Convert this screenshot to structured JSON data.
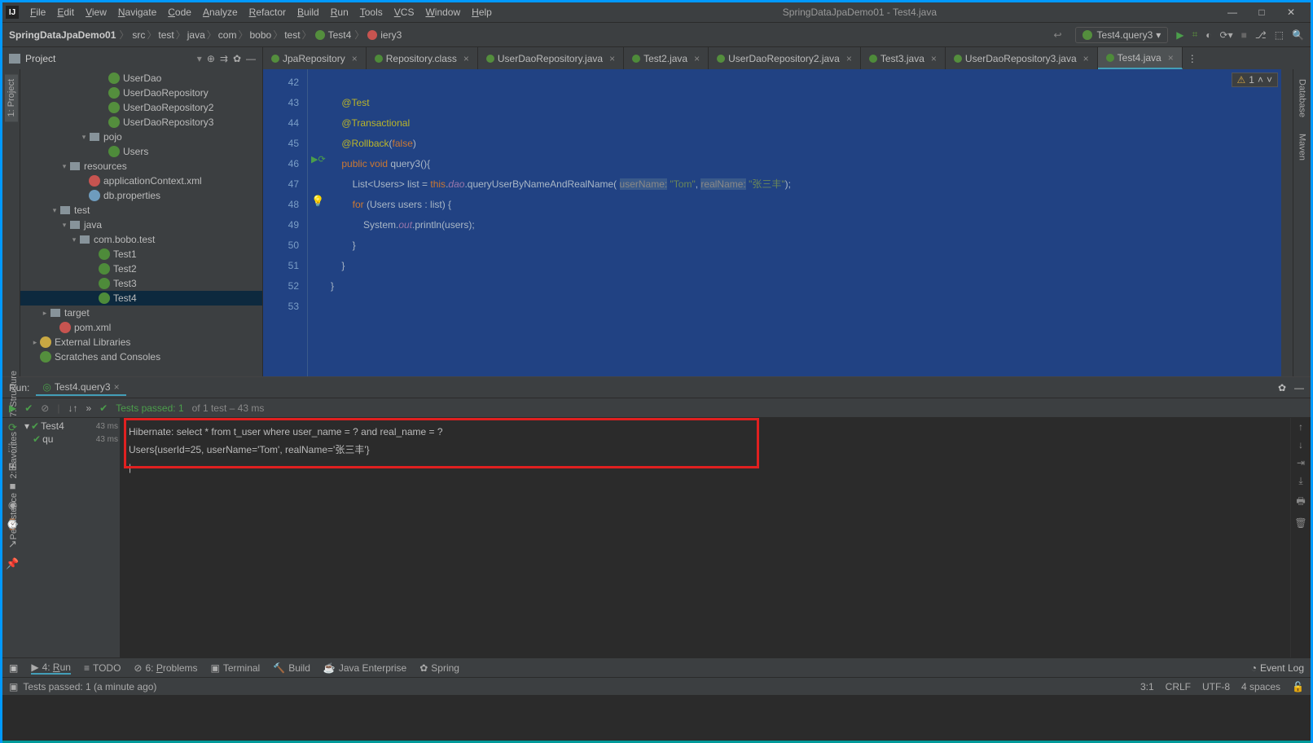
{
  "window": {
    "title": "SpringDataJpaDemo01 - Test4.java"
  },
  "menus": [
    "File",
    "Edit",
    "View",
    "Navigate",
    "Code",
    "Analyze",
    "Refactor",
    "Build",
    "Run",
    "Tools",
    "VCS",
    "Window",
    "Help"
  ],
  "breadcrumbs": {
    "project": "SpringDataJpaDemo01",
    "parts": [
      "src",
      "test",
      "java",
      "com",
      "bobo",
      "test"
    ],
    "class": "Test4",
    "method": "iery3"
  },
  "run_config": "Test4.query3",
  "project_header": "Project",
  "tree": [
    {
      "indent": 8,
      "icon": "iface",
      "label": "UserDao"
    },
    {
      "indent": 8,
      "icon": "iface",
      "label": "UserDaoRepository"
    },
    {
      "indent": 8,
      "icon": "iface",
      "label": "UserDaoRepository2"
    },
    {
      "indent": 8,
      "icon": "iface",
      "label": "UserDaoRepository3"
    },
    {
      "indent": 6,
      "arrow": "▾",
      "icon": "pkg",
      "label": "pojo"
    },
    {
      "indent": 8,
      "icon": "cls2",
      "label": "Users"
    },
    {
      "indent": 4,
      "arrow": "▾",
      "icon": "folder",
      "label": "resources"
    },
    {
      "indent": 6,
      "icon": "xml",
      "label": "applicationContext.xml"
    },
    {
      "indent": 6,
      "icon": "prop",
      "label": "db.properties"
    },
    {
      "indent": 3,
      "arrow": "▾",
      "icon": "folder",
      "label": "test"
    },
    {
      "indent": 4,
      "arrow": "▾",
      "icon": "folder",
      "label": "java"
    },
    {
      "indent": 5,
      "arrow": "▾",
      "icon": "pkg",
      "label": "com.bobo.test"
    },
    {
      "indent": 7,
      "icon": "test2",
      "label": "Test1"
    },
    {
      "indent": 7,
      "icon": "test2",
      "label": "Test2"
    },
    {
      "indent": 7,
      "icon": "test2",
      "label": "Test3"
    },
    {
      "indent": 7,
      "icon": "test2",
      "label": "Test4",
      "selected": true
    },
    {
      "indent": 2,
      "arrow": "▸",
      "icon": "folder",
      "label": "target"
    },
    {
      "indent": 3,
      "icon": "maven",
      "label": "pom.xml"
    },
    {
      "indent": 1,
      "arrow": "▸",
      "icon": "lib",
      "label": "External Libraries"
    },
    {
      "indent": 1,
      "icon": "scratch",
      "label": "Scratches and Consoles"
    }
  ],
  "tabs": [
    {
      "label": "JpaRepository",
      "icon": "int"
    },
    {
      "label": "Repository.class",
      "icon": "cls"
    },
    {
      "label": "UserDaoRepository.java",
      "icon": "int"
    },
    {
      "label": "Test2.java",
      "icon": "test"
    },
    {
      "label": "UserDaoRepository2.java",
      "icon": "int"
    },
    {
      "label": "Test3.java",
      "icon": "test"
    },
    {
      "label": "UserDaoRepository3.java",
      "icon": "int"
    },
    {
      "label": "Test4.java",
      "icon": "test",
      "active": true
    }
  ],
  "line_start": 42,
  "line_end": 53,
  "code_lines": [
    "",
    "    <ann>@Test</ann>",
    "    <ann>@Transactional</ann>",
    "    <ann>@Rollback</ann>(<kw>false</kw>)",
    "    <kw>public</kw> <kw>void</kw> query3(){",
    "        List&lt;Users&gt; list = <kw>this</kw>.<field>dao</field>.queryUserByNameAndRealName( <param>userName:</param> <str>\"Tom\"</str>, <param>realName:</param> <str>\"张三丰\"</str>);",
    "        <kw>for</kw> (Users users : list) {",
    "            System.<field>out</field>.println(users);",
    "        }",
    "    }",
    "}",
    ""
  ],
  "badge": {
    "warn": "⚠",
    "count": "1"
  },
  "run": {
    "label": "Run:",
    "tab": "Test4.query3",
    "status_prefix": "Tests passed: 1",
    "status_suffix": " of 1 test – 43 ms",
    "tree": [
      {
        "label": "Test4",
        "time": "43 ms",
        "indent": 0,
        "arrow": "▾"
      },
      {
        "label": "qu",
        "time": "43 ms",
        "indent": 1
      }
    ],
    "console": [
      "Hibernate: select * from t_user where user_name = ? and real_name = ?",
      "Users{userId=25, userName='Tom', realName='张三丰'}"
    ]
  },
  "bottom_tools": [
    {
      "icon": "▶",
      "label": "4: Run",
      "underline": "R",
      "active": true
    },
    {
      "icon": "≡",
      "label": "TODO"
    },
    {
      "icon": "⊘",
      "label": "6: Problems",
      "underline": "P"
    },
    {
      "icon": "▣",
      "label": "Terminal"
    },
    {
      "icon": "🔨",
      "label": "Build"
    },
    {
      "icon": "☕",
      "label": "Java Enterprise"
    },
    {
      "icon": "✿",
      "label": "Spring"
    }
  ],
  "event_log": "Event Log",
  "status": {
    "msg": "Tests passed: 1 (a minute ago)",
    "pos": "3:1",
    "le": "CRLF",
    "enc": "UTF-8",
    "indent": "4 spaces"
  },
  "left_rail": [
    "1: Project"
  ],
  "left_rail2": [
    "7: Structure",
    "2: Favorites",
    "Persistence"
  ],
  "right_rail": [
    "Database",
    "Maven"
  ]
}
